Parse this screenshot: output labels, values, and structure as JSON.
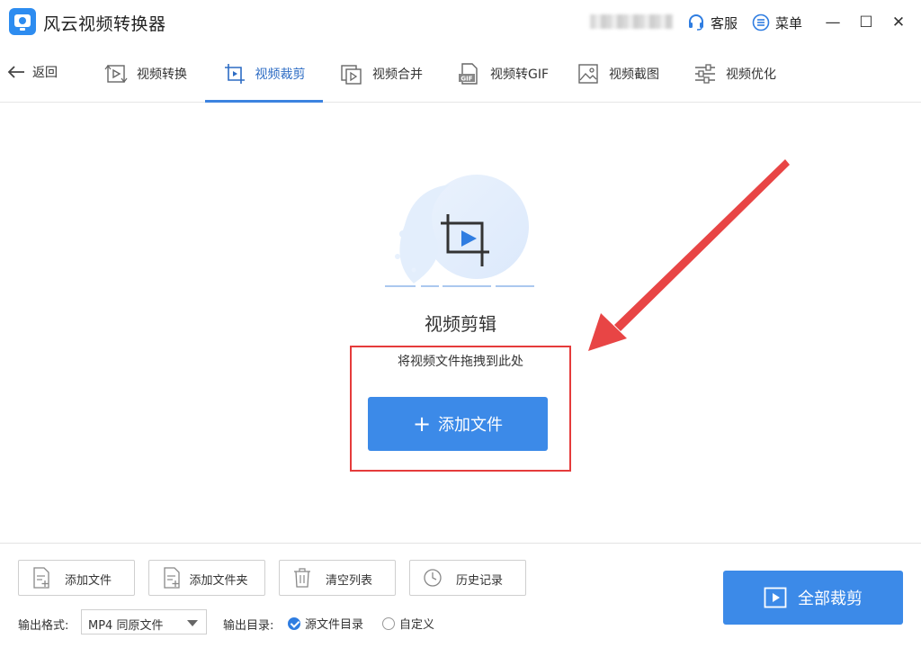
{
  "app": {
    "title": "风云视频转换器",
    "service_label": "客服",
    "menu_label": "菜单",
    "minimize_icon": "—",
    "maximize_icon": "☐",
    "close_icon": "✕"
  },
  "nav": {
    "back_label": "返回",
    "tabs": [
      {
        "label": "视频转换",
        "icon": "video-convert-icon"
      },
      {
        "label": "视频裁剪",
        "icon": "video-crop-icon",
        "active": true
      },
      {
        "label": "视频合并",
        "icon": "video-merge-icon"
      },
      {
        "label": "视频转GIF",
        "icon": "gif-icon"
      },
      {
        "label": "视频截图",
        "icon": "image-icon"
      },
      {
        "label": "视频优化",
        "icon": "sliders-icon"
      }
    ]
  },
  "main": {
    "title": "视频剪辑",
    "hint": "将视频文件拖拽到此处",
    "add_file_label": "添加文件",
    "add_file_icon": "+"
  },
  "bottom": {
    "tools": [
      {
        "label": "添加文件",
        "icon": "add-file-icon"
      },
      {
        "label": "添加文件夹",
        "icon": "add-folder-icon"
      },
      {
        "label": "清空列表",
        "icon": "trash-icon"
      },
      {
        "label": "历史记录",
        "icon": "clock-icon"
      }
    ],
    "format_label": "输出格式:",
    "format_value": "MP4 同原文件",
    "dir_label": "输出目录:",
    "dir_options": [
      {
        "label": "源文件目录",
        "checked": true
      },
      {
        "label": "自定义",
        "checked": false
      }
    ],
    "crop_all_label": "全部裁剪"
  },
  "colors": {
    "accent": "#3c8ae8",
    "highlight": "#e53b3b"
  }
}
